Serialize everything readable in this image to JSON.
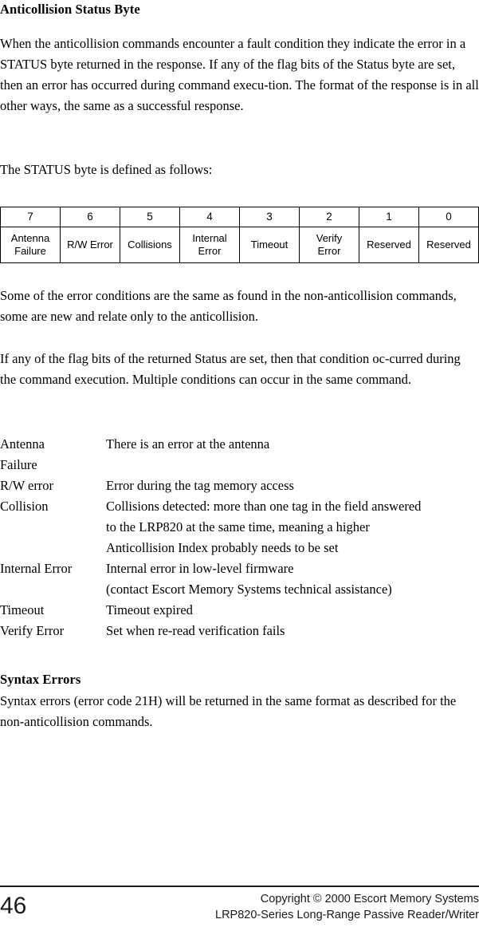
{
  "document": {
    "page_number": "46"
  },
  "heading": {
    "title": "Anticollision Status Byte"
  },
  "paragraphs": {
    "intro": "When the anticollision commands encounter a fault condition they indicate the error in a STATUS byte returned in the response. If any of the flag bits of the Status byte are set, then an error has occurred during command execu-tion. The format of the response is in all other ways, the same as a successful response.",
    "lead_in": "The STATUS byte is defined as follows:",
    "after_table": "Some of the error conditions are the same as found in the non-anticollision commands, some are new and relate only to the anticollision.",
    "flag_bits": "If any of the flag bits of the returned Status are set, then that condition oc-curred during the command execution. Multiple conditions can occur in the same command."
  },
  "status_byte_table": {
    "bit_indexes": [
      "7",
      "6",
      "5",
      "4",
      "3",
      "2",
      "1",
      "0"
    ],
    "bit_names": [
      "Antenna\nFailure",
      "R/W Error",
      "Collisions",
      "Internal\nError",
      "Timeout",
      "Verify\nError",
      "Reserved",
      "Reserved"
    ]
  },
  "definitions": [
    {
      "term": "Antenna\nFailure",
      "description": "There is an error at the antenna"
    },
    {
      "term": "R/W error",
      "description": "Error during the tag memory access"
    },
    {
      "term": "Collision",
      "description": "Collisions detected: more than one tag in the field answered\nto the LRP820 at the same time, meaning a higher\nAnticollision Index probably needs to be set"
    },
    {
      "term": "Internal Error",
      "description": "Internal error in low-level firmware\n(contact Escort Memory Systems technical assistance)"
    },
    {
      "term": "Timeout",
      "description": "Timeout expired"
    },
    {
      "term": "Verify Error",
      "description": "Set when re-read verification fails"
    }
  ],
  "syntax_errors": {
    "heading": "Syntax Errors",
    "body": "Syntax errors (error code 21H) will be returned in the same format as described for the non-anticollision commands."
  },
  "footer": {
    "copyright": "Copyright © 2000 Escort Memory Systems",
    "product": "LRP820-Series Long-Range Passive Reader/Writer"
  }
}
